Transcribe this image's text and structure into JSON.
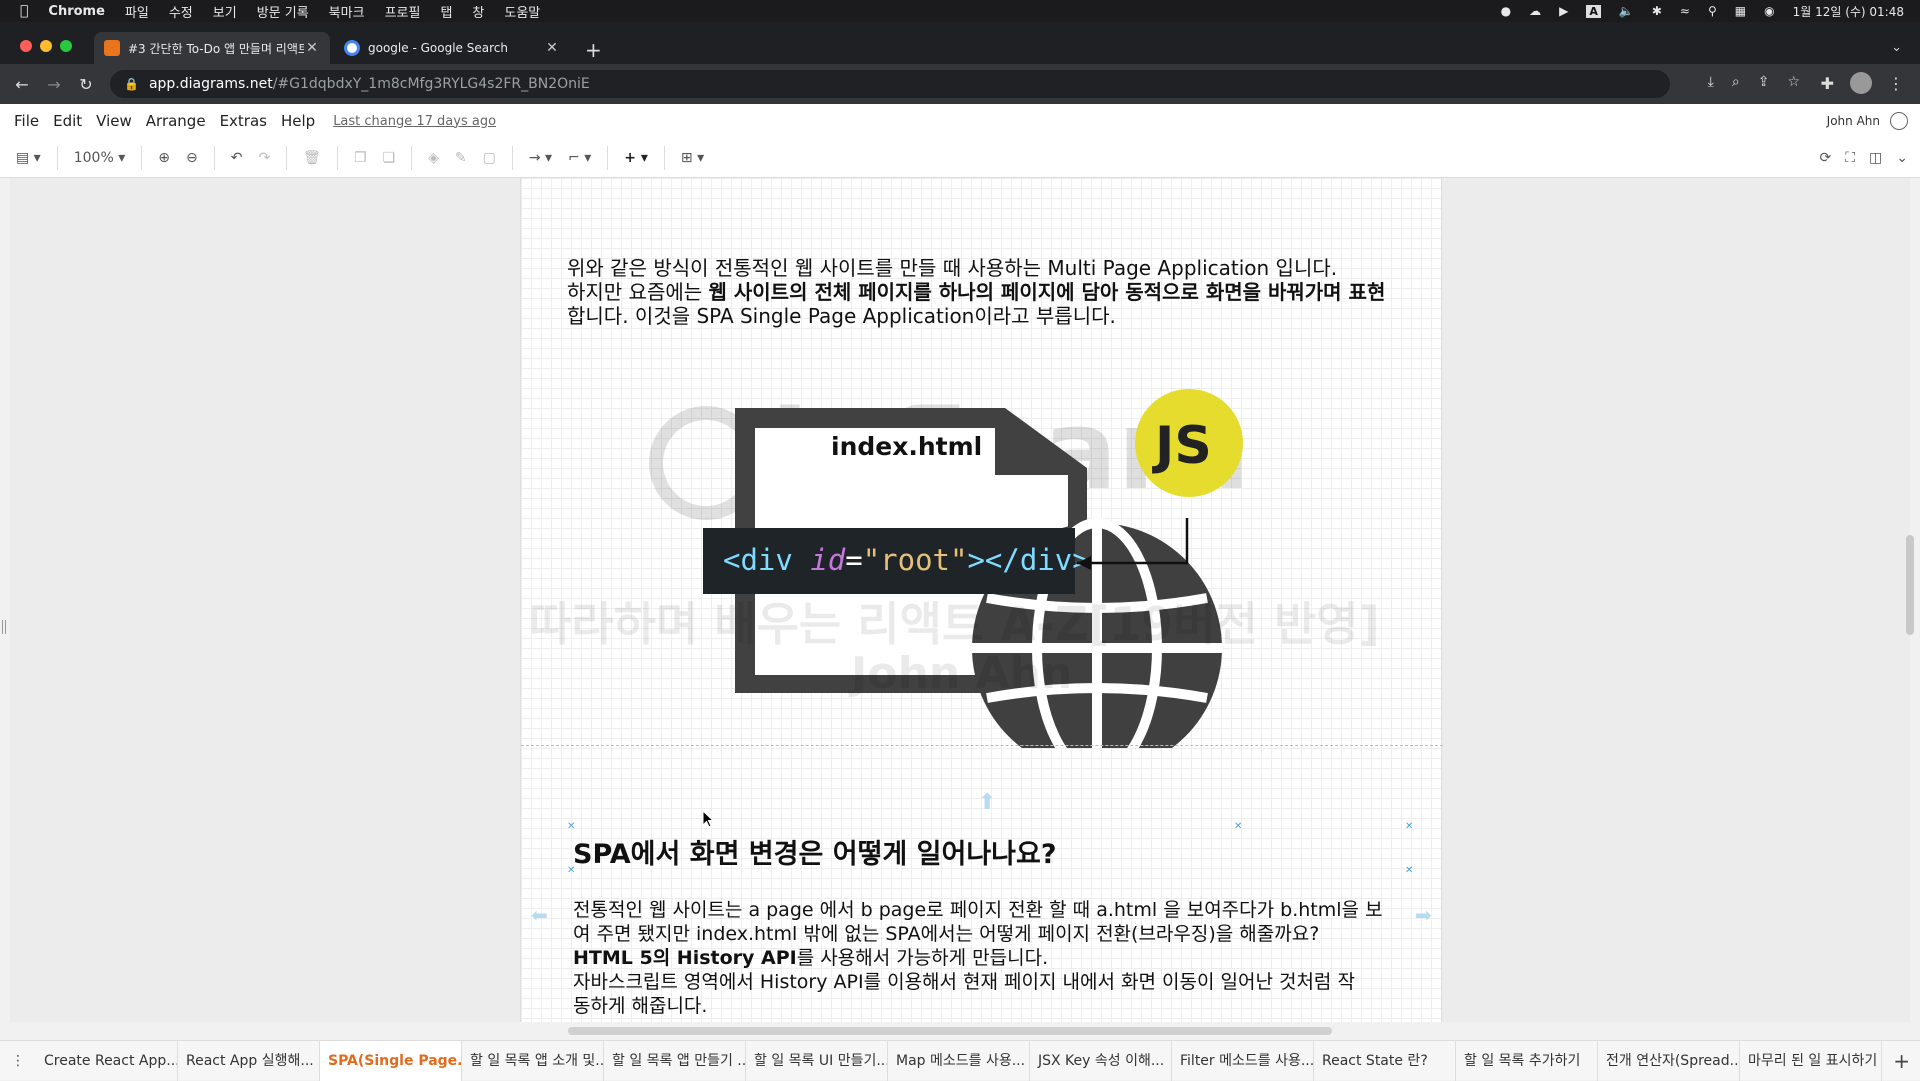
{
  "mac_menu": {
    "app": "Chrome",
    "items": [
      "파일",
      "수정",
      "보기",
      "방문 기록",
      "북마크",
      "프로필",
      "탭",
      "창",
      "도움말"
    ],
    "clock": "1월 12일 (수) 01:48"
  },
  "browser": {
    "tabs": [
      {
        "title": "#3 간단한 To-Do 앱 만들며 리액트",
        "favicon_color": "#e8741c"
      },
      {
        "title": "google - Google Search",
        "favicon_color": "#4285f4"
      }
    ],
    "url_host": "app.diagrams.net",
    "url_path": "/#G1dqbdxY_1m8cMfg3RYLG4s2FR_BN2OniE"
  },
  "drawio_menu": {
    "items": [
      "File",
      "Edit",
      "View",
      "Arrange",
      "Extras",
      "Help"
    ],
    "last_change": "Last change 17 days ago",
    "user": "John Ahn"
  },
  "drawio_toolbar": {
    "zoom": "100%"
  },
  "content": {
    "p1_line1": "위와 같은 방식이 전통적인 웹 사이트를 만들 때 사용하는 Multi Page Application 입니다.",
    "p1_line2_pre": "하지만 요즘에는 ",
    "p1_line2_bold": "웹 사이트의 전체 페이지를 하나의 페이지에 담아 동적으로 화면을 바꿔가며 표현",
    "p1_line3": "합니다. 이것을 SPA Single Page Application이라고 부릅니다.",
    "diagram": {
      "file_label": "index.html",
      "code_open": "<div ",
      "code_attr": "id",
      "code_eq": "=",
      "code_value": "\"root\"",
      "code_close": "></div>",
      "js_badge": "JS",
      "watermark_line1": "따라하며 배우는 리액트 A-Z[19버전 반영]",
      "watermark_line2": "John Ahn"
    },
    "heading": "SPA에서 화면 변경은 어떻게 일어나나요?",
    "p2_line1": "전통적인 웹 사이트는 a page 에서 b page로 페이지 전환 할 때 a.html 을 보여주다가 b.html을 보",
    "p2_line2": "여 주면 됐지만 index.html 밖에 없는 SPA에서는 어떻게 페이지 전환(브라우징)을 해줄까요?",
    "p2_line3_bold": "HTML 5의 History API",
    "p2_line3_rest": "를 사용해서 가능하게 만듭니다.",
    "p2_line4": "자바스크립트 영역에서 History API를 이용해서 현재 페이지 내에서 화면 이동이 일어난 것처럼 작",
    "p2_line5": "동하게 해줍니다."
  },
  "page_tabs": [
    "Create React App...",
    "React App 실행해...",
    "SPA(Single Page...",
    "할 일 목록 앱 소개 및...",
    "할 일 목록 앱 만들기 ...",
    "할 일 목록 UI 만들기...",
    "Map 메소드를 사용...",
    "JSX Key 속성 이해...",
    "Filter 메소드를 사용...",
    "React State 란?",
    "할 일 목록 추가하기",
    "전개 연산자(Spread...",
    "마무리 된 일 표시하기"
  ],
  "active_page_tab": "SPA(Single Page..."
}
